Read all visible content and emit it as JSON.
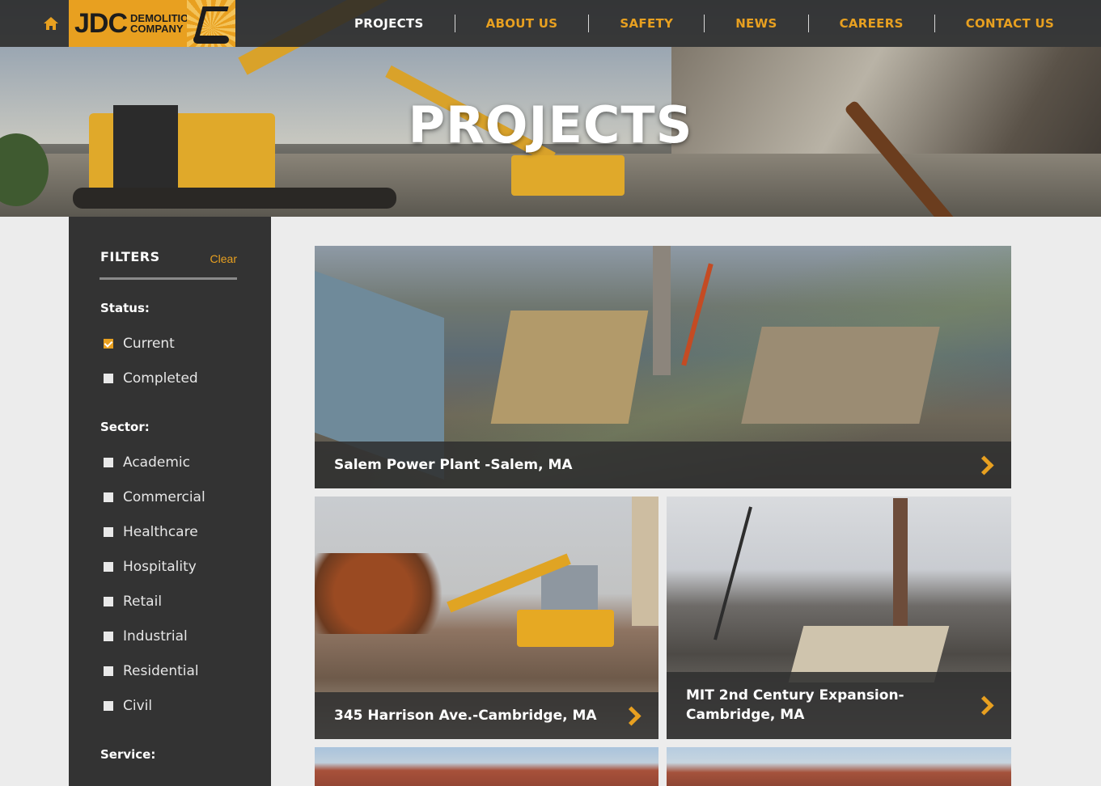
{
  "header": {
    "logo": {
      "main": "JDC",
      "line1": "DEMOLITION",
      "line2": "COMPANY"
    },
    "home_icon": "home-icon",
    "nav": [
      {
        "label": "PROJECTS",
        "active": true
      },
      {
        "label": "ABOUT US",
        "active": false
      },
      {
        "label": "SAFETY",
        "active": false
      },
      {
        "label": "NEWS",
        "active": false
      },
      {
        "label": "CAREERS",
        "active": false
      },
      {
        "label": "CONTACT US",
        "active": false
      }
    ]
  },
  "hero": {
    "title": "PROJECTS"
  },
  "filters": {
    "title": "FILTERS",
    "clear_label": "Clear",
    "status_label": "Status:",
    "status_options": [
      {
        "label": "Current",
        "checked": true
      },
      {
        "label": "Completed",
        "checked": false
      }
    ],
    "sector_label": "Sector:",
    "sector_options": [
      {
        "label": "Academic",
        "checked": false
      },
      {
        "label": "Commercial",
        "checked": false
      },
      {
        "label": "Healthcare",
        "checked": false
      },
      {
        "label": "Hospitality",
        "checked": false
      },
      {
        "label": "Retail",
        "checked": false
      },
      {
        "label": "Industrial",
        "checked": false
      },
      {
        "label": "Residential",
        "checked": false
      },
      {
        "label": "Civil",
        "checked": false
      }
    ],
    "service_label": "Service:"
  },
  "projects": [
    {
      "title": "Salem Power Plant -Salem, MA"
    },
    {
      "title": "345 Harrison Ave.-Cambridge, MA"
    },
    {
      "title_line1": "MIT 2nd Century Expansion-",
      "title_line2": "Cambridge, MA"
    }
  ],
  "colors": {
    "accent": "#e8a020",
    "dark": "#333333",
    "page_bg": "#ececec"
  }
}
